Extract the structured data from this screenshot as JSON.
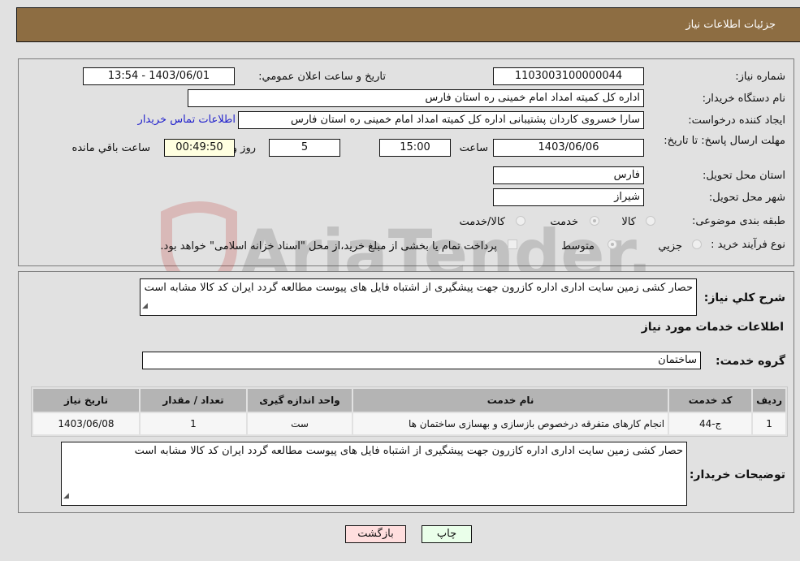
{
  "header": {
    "title": "جزئیات اطلاعات نیاز"
  },
  "form": {
    "need_number_label": "شماره نیاز:",
    "need_number": "1103003100000044",
    "announce_label": "تاريخ و ساعت اعلان عمومي:",
    "announce_value": "1403/06/01 - 13:54",
    "buyer_org_label": "نام دستگاه خریدار:",
    "buyer_org": "اداره کل کمیته امداد امام خمینی  ره  استان فارس",
    "creator_label": "ایجاد کننده درخواست:",
    "creator": "سارا خسروی کاردان پشتیبانی  اداره کل کمیته امداد امام خمینی  ره  استان فارس",
    "contact_link": "اطلاعات تماس خریدار",
    "deadline_label": "مهلت ارسال پاسخ: تا تاریخ:",
    "deadline_date": "1403/06/06",
    "time_label": "ساعت",
    "deadline_time": "15:00",
    "days_value": "5",
    "days_label": "روز و",
    "remaining_time": "00:49:50",
    "remaining_label": "ساعت باقي مانده",
    "province_label": "استان محل تحویل:",
    "province": "فارس",
    "city_label": "شهر محل تحویل:",
    "city": "شیراز",
    "category_label": "طبقه بندی موضوعی:",
    "category_options": [
      "کالا",
      "خدمت",
      "کالا/خدمت"
    ],
    "category_selected": "خدمت",
    "process_label": "نوع فرآیند خرید :",
    "process_options": [
      "جزيي",
      "متوسط"
    ],
    "process_selected": "متوسط",
    "payment_note": "پرداخت تمام یا بخشی از مبلغ خرید،از محل \"اسناد خزانه اسلامی\" خواهد بود."
  },
  "details": {
    "description_label": "شرح کلي نياز:",
    "description": "حصار کشی زمین سایت اداری اداره کازرون جهت پیشگیری از اشتباه فایل های پیوست مطالعه گردد ایران کد کالا مشابه است",
    "services_title": "اطلاعات خدمات مورد نیاز",
    "service_group_label": "گروه خدمت:",
    "service_group": "ساختمان",
    "table": {
      "headers": [
        "ردیف",
        "کد خدمت",
        "نام خدمت",
        "واحد اندازه گیری",
        "تعداد / مقدار",
        "تاریخ نیاز"
      ],
      "rows": [
        [
          "1",
          "ج-44",
          "انجام کارهای متفرقه درخصوص بازسازی و بهسازی ساختمان ها",
          "ست",
          "1",
          "1403/06/08"
        ]
      ]
    },
    "buyer_notes_label": "توضیحات خریدار:",
    "buyer_notes": "حصار کشی زمین سایت اداری اداره کازرون جهت پیشگیری از اشتباه فایل های پیوست مطالعه گردد ایران کد کالا مشابه است"
  },
  "buttons": {
    "print": "چاپ",
    "back": "بازگشت"
  },
  "watermark": {
    "text": "AriaTender.neT"
  },
  "colors": {
    "header_bg": "#8d6d42",
    "print_bg": "#eaffea",
    "back_bg": "#ffdede",
    "link": "#2222cc"
  }
}
